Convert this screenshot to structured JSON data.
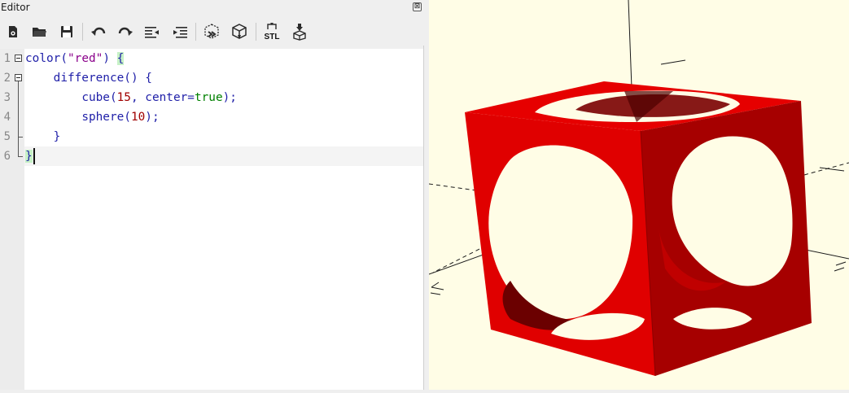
{
  "editor": {
    "title": "Editor",
    "close_glyph": "⊠"
  },
  "toolbar": {
    "buttons": [
      {
        "name": "new-file-icon"
      },
      {
        "name": "open-folder-icon"
      },
      {
        "name": "save-icon"
      },
      {
        "name": "undo-icon"
      },
      {
        "name": "redo-icon"
      },
      {
        "name": "unindent-icon"
      },
      {
        "name": "indent-icon"
      },
      {
        "name": "preview-icon"
      },
      {
        "name": "render-icon"
      },
      {
        "name": "export-stl-icon",
        "label": "STL"
      },
      {
        "name": "send-to-print-icon"
      }
    ]
  },
  "code": {
    "lines": [
      {
        "number": "1",
        "tokens": [
          [
            "color",
            "kw"
          ],
          [
            "(",
            "p"
          ],
          [
            "\"red\"",
            "str"
          ],
          [
            ")",
            "p"
          ],
          [
            " ",
            "p"
          ],
          [
            "{",
            "brace"
          ]
        ]
      },
      {
        "number": "2",
        "tokens": [
          [
            "    ",
            "p"
          ],
          [
            "difference",
            "kw"
          ],
          [
            "() {",
            "p"
          ]
        ]
      },
      {
        "number": "3",
        "tokens": [
          [
            "        ",
            "p"
          ],
          [
            "cube",
            "kw"
          ],
          [
            "(",
            "p"
          ],
          [
            "15",
            "num"
          ],
          [
            ", center=",
            "p"
          ],
          [
            "true",
            "bool"
          ],
          [
            ");",
            "p"
          ]
        ]
      },
      {
        "number": "4",
        "tokens": [
          [
            "        ",
            "p"
          ],
          [
            "sphere",
            "kw"
          ],
          [
            "(",
            "p"
          ],
          [
            "10",
            "num"
          ],
          [
            ");",
            "p"
          ]
        ]
      },
      {
        "number": "5",
        "tokens": [
          [
            "    ",
            "p"
          ],
          [
            "}",
            "p"
          ]
        ]
      },
      {
        "number": "6",
        "tokens": [
          [
            "}",
            "brace"
          ]
        ]
      }
    ]
  },
  "colors": {
    "kw": "#1f1fa8",
    "p": "#1f1fa8",
    "str": "#8b008b",
    "num": "#a00000",
    "bool": "#008000",
    "brace": "#1f1fa8",
    "brace_bg": "#c6f1c6",
    "viewport_bg": "#fffde6",
    "model_face_light": "#e60000",
    "model_face_mid": "#d40000",
    "model_face_dark": "#8f0000"
  },
  "viewport": {
    "model": "red cube with spherical cavity"
  }
}
